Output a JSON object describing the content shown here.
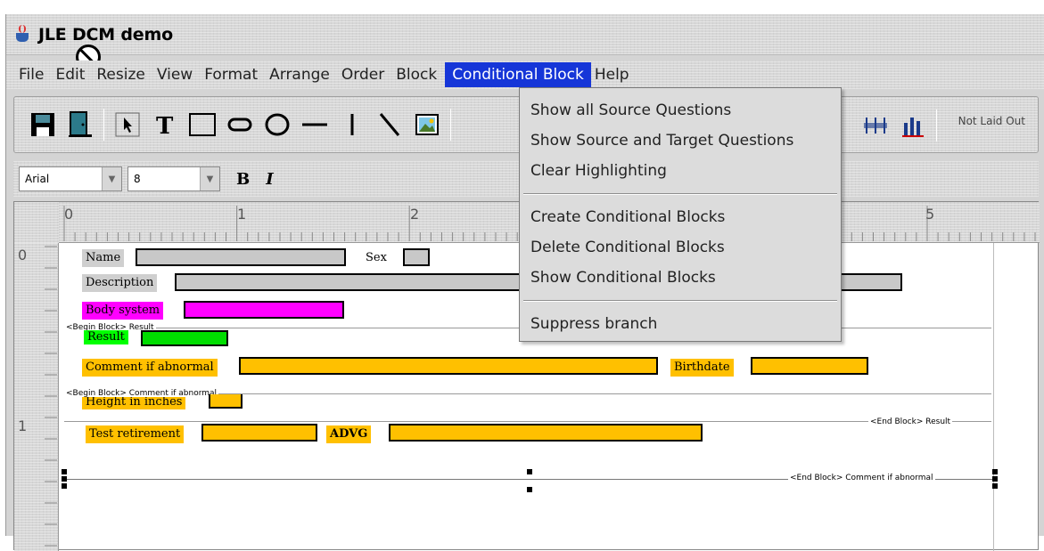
{
  "window": {
    "title": "JLE DCM demo"
  },
  "menubar": {
    "items": [
      {
        "id": "file",
        "label": "File"
      },
      {
        "id": "edit",
        "label": "Edit"
      },
      {
        "id": "resize",
        "label": "Resize"
      },
      {
        "id": "view",
        "label": "View"
      },
      {
        "id": "format",
        "label": "Format"
      },
      {
        "id": "arrange",
        "label": "Arrange"
      },
      {
        "id": "order",
        "label": "Order"
      },
      {
        "id": "block",
        "label": "Block"
      },
      {
        "id": "conditional",
        "label": "Conditional Block",
        "active": true
      },
      {
        "id": "help",
        "label": "Help"
      }
    ]
  },
  "toolbar": {
    "icons": [
      "save-icon",
      "exit-icon",
      "pointer-icon",
      "text-icon",
      "rectangle-icon",
      "rounded-rect-icon",
      "oval-icon",
      "horizontal-line-icon",
      "vertical-line-icon",
      "diagonal-line-icon",
      "image-icon"
    ],
    "right_icons": [
      "distribute-horizontal-icon",
      "bar-chart-icon"
    ],
    "status_text": "Not Laid Out"
  },
  "format": {
    "font_name": "Arial",
    "font_size": "8",
    "bold_label": "B",
    "italic_label": "I"
  },
  "ruler": {
    "h_numbers": [
      "0",
      "1",
      "2",
      "5"
    ],
    "v_numbers": [
      "0",
      "1"
    ]
  },
  "form": {
    "name_label": "Name",
    "sex_label": "Sex",
    "description_label": "Description",
    "body_system_label": "Body system",
    "result_label": "Result",
    "comment_label": "Comment if abnormal",
    "birthdate_label": "Birthdate",
    "height_label": "Height in inches",
    "test_retirement_label": "Test retirement",
    "advg_label": "ADVG",
    "begin_block_result": "<Begin Block> Result",
    "begin_block_comment": "<Begin Block> Comment if abnormal",
    "end_block_result": "<End Block> Result",
    "end_block_comment": "<End Block> Comment if abnormal"
  },
  "dropdown": {
    "groups": [
      [
        "Show all Source Questions",
        "Show Source and Target Questions",
        "Clear Highlighting"
      ],
      [
        "Create Conditional Blocks",
        "Delete Conditional Blocks",
        "Show Conditional Blocks"
      ],
      [
        "Suppress branch"
      ]
    ]
  }
}
